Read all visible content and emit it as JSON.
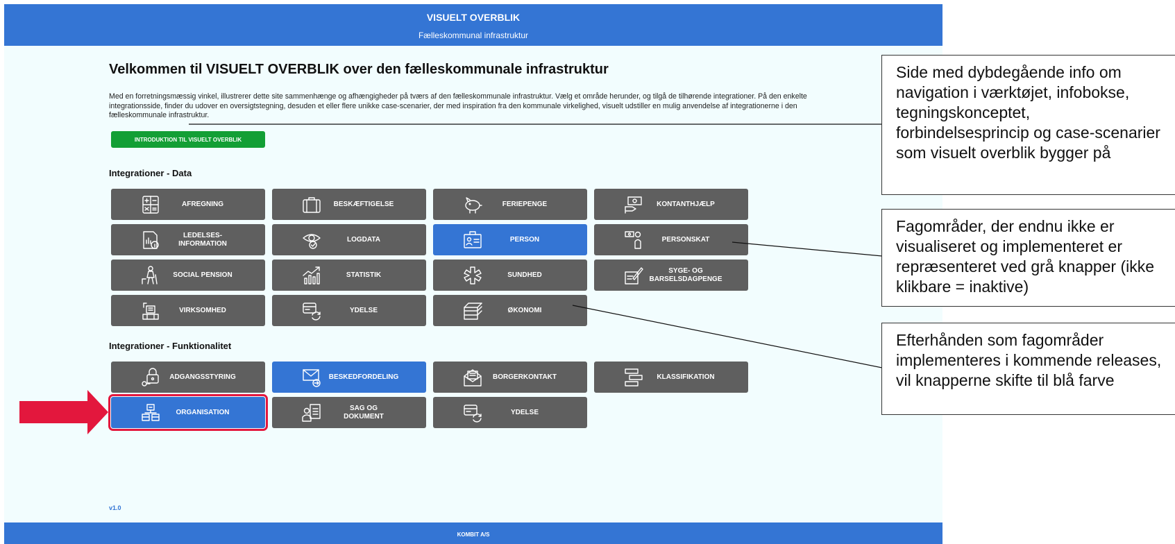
{
  "header": {
    "title": "VISUELT OVERBLIK",
    "subtitle": "Fælleskommunal infrastruktur"
  },
  "main": {
    "heading": "Velkommen til VISUELT OVERBLIK over den fælleskommunale infrastruktur",
    "intro": "Med en forretningsmæssig vinkel, illustrerer dette site sammenhænge og afhængigheder på tværs af den fælleskommunale infrastruktur. Vælg et område herunder, og tilgå de tilhørende integrationer. På den enkelte integrationsside, finder du udover en oversigtstegning, desuden et eller flere unikke case-scenarier, der med inspiration fra den kommunale virkelighed, visuelt udstiller en mulig anvendelse af integrationerne i den fælleskommunale infrastruktur.",
    "intro_button": "INTRODUKTION TIL VISUELT OVERBLIK",
    "section_data": "Integrationer - Data",
    "section_func": "Integrationer - Funktionalitet",
    "version": "v1.0"
  },
  "data_tiles": [
    {
      "label": "AFREGNING",
      "icon": "calculator-icon",
      "active": false
    },
    {
      "label": "BESKÆFTIGELSE",
      "icon": "briefcase-icon",
      "active": false
    },
    {
      "label": "FERIEPENGE",
      "icon": "piggy-bank-icon",
      "active": false
    },
    {
      "label": "KONTANTHJÆLP",
      "icon": "cash-hand-icon",
      "active": false
    },
    {
      "label": "LEDELSES-\nINFORMATION",
      "icon": "report-info-icon",
      "active": false
    },
    {
      "label": "LOGDATA",
      "icon": "eye-check-icon",
      "active": false
    },
    {
      "label": "PERSON",
      "icon": "id-card-icon",
      "active": true
    },
    {
      "label": "PERSONSKAT",
      "icon": "money-person-icon",
      "active": false
    },
    {
      "label": "SOCIAL PENSION",
      "icon": "elderly-person-icon",
      "active": false
    },
    {
      "label": "STATISTIK",
      "icon": "bar-chart-icon",
      "active": false
    },
    {
      "label": "SUNDHED",
      "icon": "medical-cross-icon",
      "active": false
    },
    {
      "label": "SYGE- OG\nBARSELSDAGPENGE",
      "icon": "document-pen-icon",
      "active": false
    },
    {
      "label": "VIRKSOMHED",
      "icon": "building-icon",
      "active": false
    },
    {
      "label": "YDELSE",
      "icon": "card-refresh-icon",
      "active": false
    },
    {
      "label": "ØKONOMI",
      "icon": "money-stack-icon",
      "active": false
    }
  ],
  "func_tiles": [
    {
      "label": "ADGANGSSTYRING",
      "icon": "lock-key-icon",
      "active": false
    },
    {
      "label": "BESKEDFORDELING",
      "icon": "mail-forward-icon",
      "active": true
    },
    {
      "label": "BORGERKONTAKT",
      "icon": "letter-icon",
      "active": false
    },
    {
      "label": "KLASSIFIKATION",
      "icon": "hierarchy-icon",
      "active": false
    },
    {
      "label": "ORGANISATION",
      "icon": "org-chart-icon",
      "active": true,
      "selected": true
    },
    {
      "label": "SAG OG\nDOKUMENT",
      "icon": "person-document-icon",
      "active": false
    },
    {
      "label": "YDELSE",
      "icon": "card-refresh-icon",
      "active": false
    }
  ],
  "footer": {
    "label": "KOMBIT A/S"
  },
  "callouts": {
    "c1": "Side med dybdegående info om navigation i værktøjet, infobokse, tegningskonceptet, forbindelsesprincip og case-scenarier som visuelt overblik bygger på",
    "c2": "Fagområder, der endnu ikke er visualiseret og implementeret er repræsenteret ved grå knapper (ikke klikbare = inaktive)",
    "c3": "Efterhånden som fagområder implementeres i kommende releases, vil knapperne skifte til blå farve"
  },
  "colors": {
    "blue": "#3475d4",
    "gray": "#5f5f5f",
    "green": "#139f35",
    "red": "#e3173d",
    "background": "#f2fdfe"
  }
}
